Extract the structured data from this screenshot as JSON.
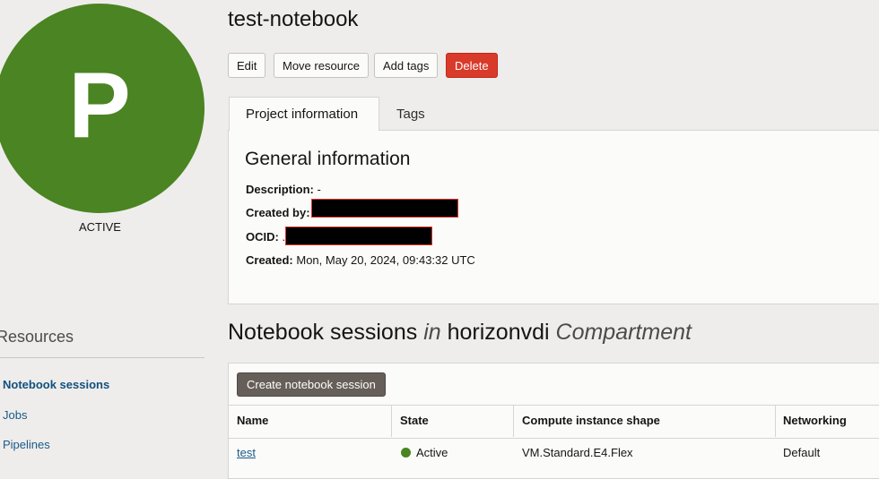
{
  "project": {
    "avatar_letter": "P",
    "state": "ACTIVE",
    "title": "test-notebook"
  },
  "actions": {
    "edit": "Edit",
    "move": "Move resource",
    "add_tags": "Add tags",
    "delete": "Delete"
  },
  "tabs": [
    "Project information",
    "Tags"
  ],
  "general": {
    "title": "General information",
    "description_label": "Description:",
    "description_value": "-",
    "created_by_label": "Created by:",
    "ocid_label": "OCID:",
    "ocid_prefix": ".",
    "created_label": "Created:",
    "created_value": "Mon, May 20, 2024, 09:43:32 UTC"
  },
  "resources": {
    "title": "Resources",
    "items": [
      "Notebook sessions",
      "Jobs",
      "Pipelines"
    ]
  },
  "sessions": {
    "title_main": "Notebook sessions",
    "title_in": "in",
    "compartment_name": "horizonvdi",
    "compartment_word": "Compartment",
    "create_button": "Create notebook session",
    "columns": [
      "Name",
      "State",
      "Compute instance shape",
      "Networking"
    ],
    "rows": [
      {
        "name": "test",
        "state": "Active",
        "shape": "VM.Standard.E4.Flex",
        "networking": "Default"
      }
    ]
  },
  "colors": {
    "avatar": "#4b8422",
    "delete": "#d93b2b",
    "link": "#1a5a89",
    "active_status": "#4b8422"
  }
}
